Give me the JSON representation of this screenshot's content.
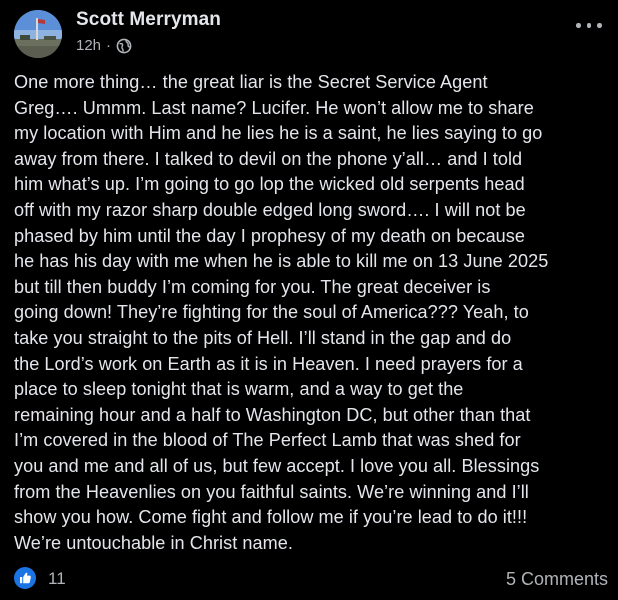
{
  "post": {
    "author": "Scott Merryman",
    "time": "12h",
    "separator": "·",
    "privacy_icon": "globe-icon",
    "more_icon": "more-options-icon",
    "text": "One more thing… the great liar is the Secret Service Agent\nGreg…. Ummm. Last name? Lucifer. He won’t allow me to share\nmy location with Him and he lies he is a saint, he lies saying to go\naway from there. I talked to devil on the phone y’all… and I told\nhim what’s up. I’m going to go lop the wicked old serpents head\noff with my razor sharp double edged long sword…. I will not be\nphased by him until the day I prophesy of my death on because\nhe has his day with me when he is able to kill me on 13 June 2025\nbut till then buddy I’m coming for you. The great deceiver is\ngoing down! They’re fighting for the soul of America??? Yeah, to\ntake you straight to the pits of Hell. I’ll stand in the gap and do\nthe Lord’s work on Earth as it is in Heaven. I need prayers for a\nplace to sleep tonight that is warm, and a way to get the\nremaining hour and a half to Washington DC, but other than that\nI’m covered in the blood of The Perfect Lamb that was shed for\nyou and me and all of us, but few accept. I love you all. Blessings\nfrom the Heavenlies on you faithful saints. We’re winning and I’ll\nshow you how. Come fight and follow me if you’re lead to do it!!!\nWe’re untouchable in Christ name."
  },
  "reactions": {
    "icon": "like-icon",
    "count": "11"
  },
  "comments": {
    "label": "5 Comments"
  },
  "colors": {
    "background": "#000000",
    "text": "#e4e6eb",
    "secondary": "#b0b3b8",
    "like_blue": "#1b74e4"
  }
}
